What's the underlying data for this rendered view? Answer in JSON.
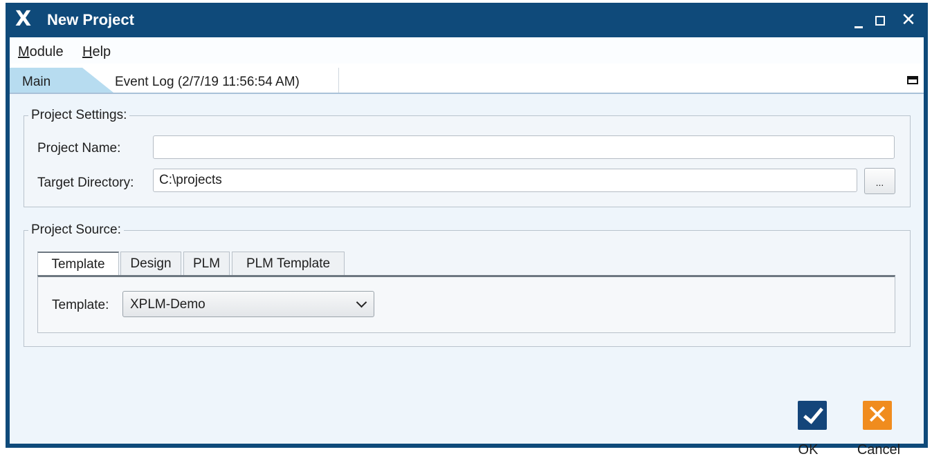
{
  "window": {
    "title": "New Project",
    "app_icon": "X",
    "close_glyph": "✕"
  },
  "menu": [
    "Module",
    "Help"
  ],
  "tabs": {
    "main": "Main",
    "event_log": "Event Log (2/7/19 11:56:54 AM)"
  },
  "project_settings": {
    "legend": "Project Settings:",
    "name_label": "Project Name:",
    "name_value": "",
    "dir_label": "Target Directory:",
    "dir_value": "C:\\projects",
    "browse_label": "..."
  },
  "project_source": {
    "legend": "Project Source:",
    "tabs": [
      "Template",
      "Design",
      "PLM",
      "PLM Template"
    ],
    "active_tab": "Template",
    "template_label": "Template:",
    "template_value": "XPLM-Demo"
  },
  "actions": {
    "ok_label": "OK",
    "cancel_label": "Cancel"
  },
  "colors": {
    "titlebar": "#0f4a7a",
    "ok_icon": "#14457a",
    "cancel_icon": "#f08c1e",
    "active_tab": "#b7dcf0"
  },
  "icons": {
    "ok": "checkmark-icon",
    "cancel": "x-icon",
    "app": "app-logo-icon"
  }
}
